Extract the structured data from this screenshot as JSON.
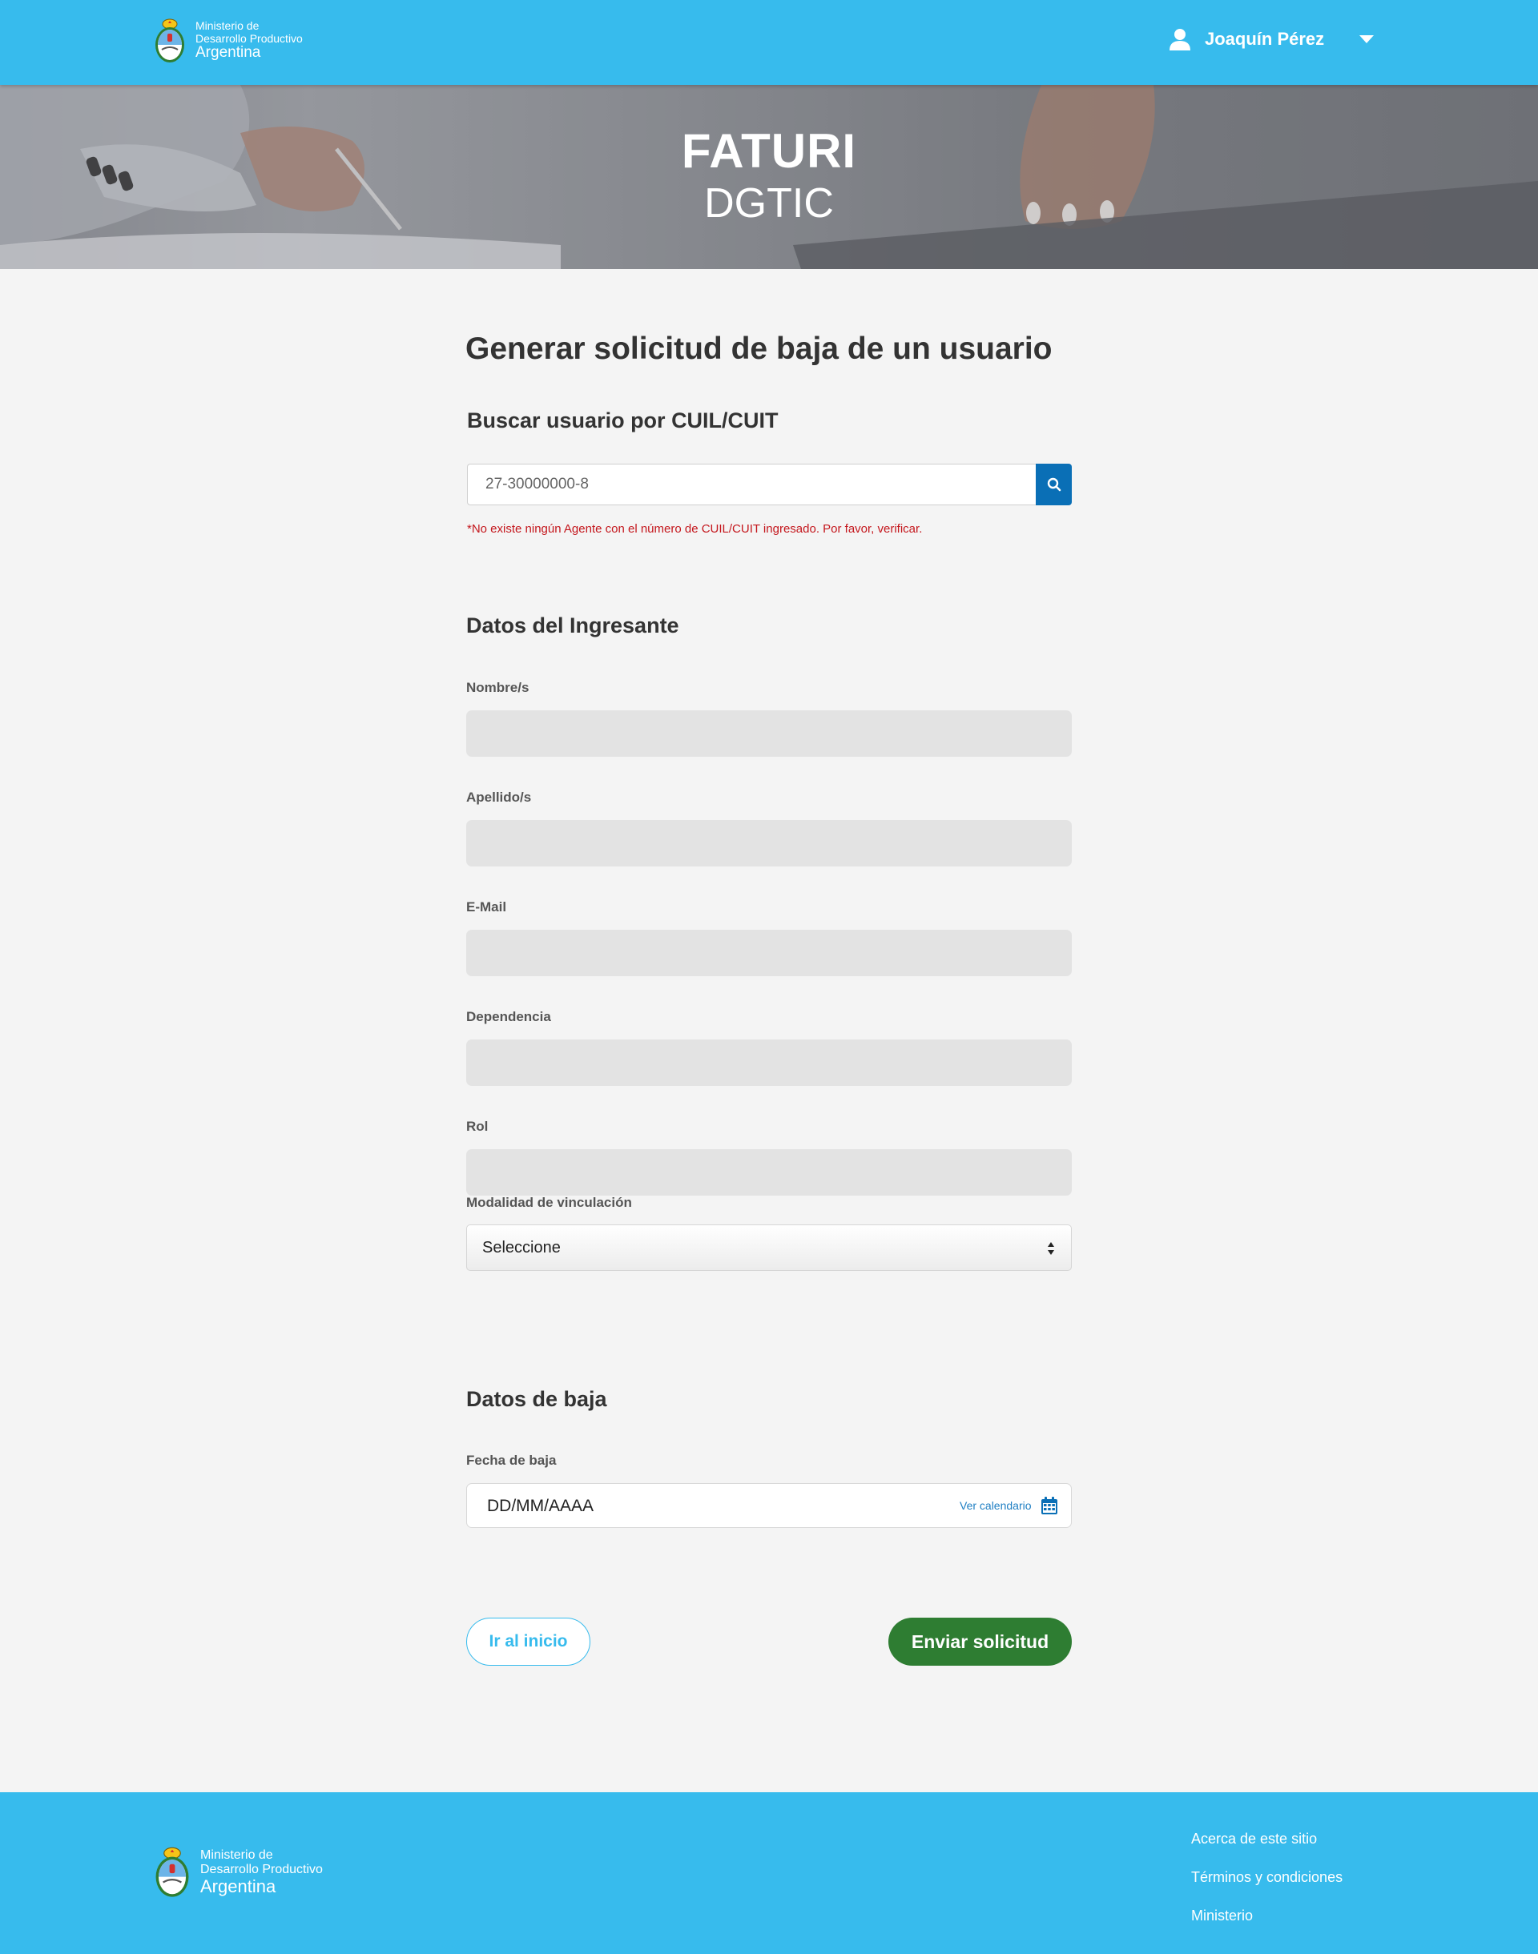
{
  "header": {
    "brand_line1": "Ministerio de",
    "brand_line2": "Desarrollo Productivo",
    "brand_line3": "Argentina",
    "user_name": "Joaquín Pérez"
  },
  "hero": {
    "title": "FATURI",
    "subtitle": "DGTIC"
  },
  "main": {
    "title": "Generar solicitud de baja de un usuario",
    "search": {
      "label": "Buscar usuario por CUIL/CUIT",
      "value": "27-30000000-8",
      "error": "*No existe ningún Agente con el número de CUIL/CUIT ingresado. Por favor, verificar."
    },
    "ingresante": {
      "title": "Datos del Ingresante",
      "nombre_label": "Nombre/s",
      "apellido_label": "Apellido/s",
      "email_label": "E-Mail",
      "dependencia_label": "Dependencia",
      "rol_label": "Rol",
      "modalidad_label": "Modalidad de vinculación",
      "modalidad_value": "Seleccione"
    },
    "baja": {
      "title": "Datos de baja",
      "fecha_label": "Fecha de baja",
      "fecha_placeholder": "DD/MM/AAAA",
      "calendar_link": "Ver calendario"
    },
    "buttons": {
      "home": "Ir al inicio",
      "send": "Enviar solicitud"
    }
  },
  "footer": {
    "brand_line1": "Ministerio de",
    "brand_line2": "Desarrollo Productivo",
    "brand_line3": "Argentina",
    "links": [
      "Acerca de este sitio",
      "Términos y condiciones",
      "Ministerio"
    ]
  },
  "colors": {
    "primary": "#37bbed",
    "search_button": "#0a6fb6",
    "error": "#c4161c",
    "send_button": "#2e7d32",
    "background": "#f4f4f4"
  },
  "icons": [
    "coat-of-arms-icon",
    "user-icon",
    "chevron-down-icon",
    "search-icon",
    "calendar-icon"
  ]
}
